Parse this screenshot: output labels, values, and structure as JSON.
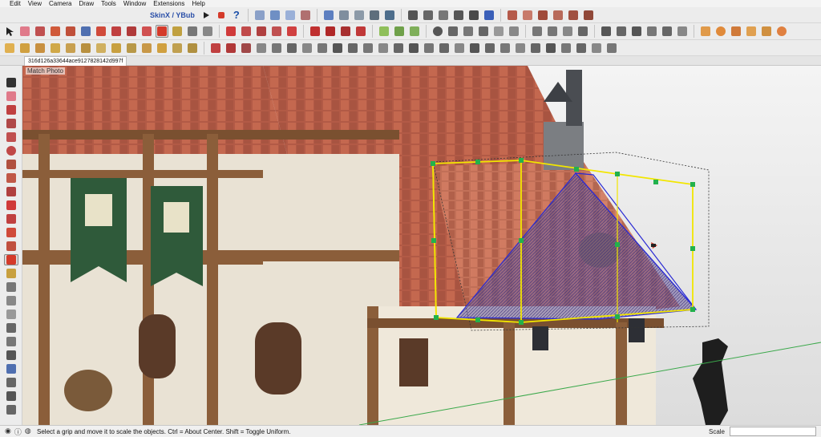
{
  "menu": [
    "Edit",
    "View",
    "Camera",
    "Draw",
    "Tools",
    "Window",
    "Extensions",
    "Help"
  ],
  "skin_label": "SkinX / YBub",
  "document_tab": "316d126a33644ace9127828142d997f",
  "scene_label": "Match Photo",
  "status": {
    "message": "Select a grip and move it to scale the objects. Ctrl = About Center. Shift = Toggle Uniform.",
    "measurement_label": "Scale",
    "measurement_value": ""
  },
  "colors": {
    "accent_active": "#d43a2a",
    "grip": "#22b14c",
    "bounding_box": "#f2e600",
    "selection": "#2a2ad4"
  }
}
